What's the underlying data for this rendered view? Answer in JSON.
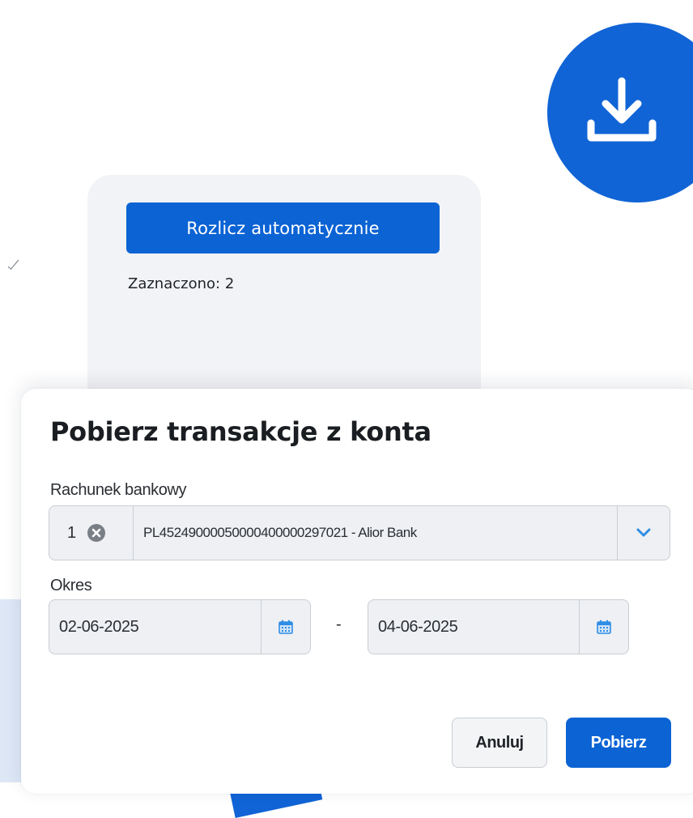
{
  "colors": {
    "primary": "#0b63d4",
    "download_circle": "#1164d6",
    "card_background": "#f2f3f6",
    "field_background": "#eef0f3",
    "calendar_icon": "#2f8de4"
  },
  "download_action": {
    "icon": "download-icon"
  },
  "settlement_card": {
    "auto_settle_label": "Rozlicz automatycznie",
    "selected_label": "Zaznaczono: 2"
  },
  "dialog": {
    "title": "Pobierz transakcje z konta",
    "account_field": {
      "label": "Rachunek bankowy",
      "selected_count": "1",
      "value": "PL45249000050000400000297021 - Alior Bank",
      "clear_icon": "clear-icon",
      "dropdown_icon": "chevron-down-icon"
    },
    "period_field": {
      "label": "Okres",
      "from": "02-06-2025",
      "separator": "-",
      "to": "04-06-2025",
      "picker_icon": "calendar-icon"
    },
    "actions": {
      "cancel_label": "Anuluj",
      "submit_label": "Pobierz"
    }
  }
}
